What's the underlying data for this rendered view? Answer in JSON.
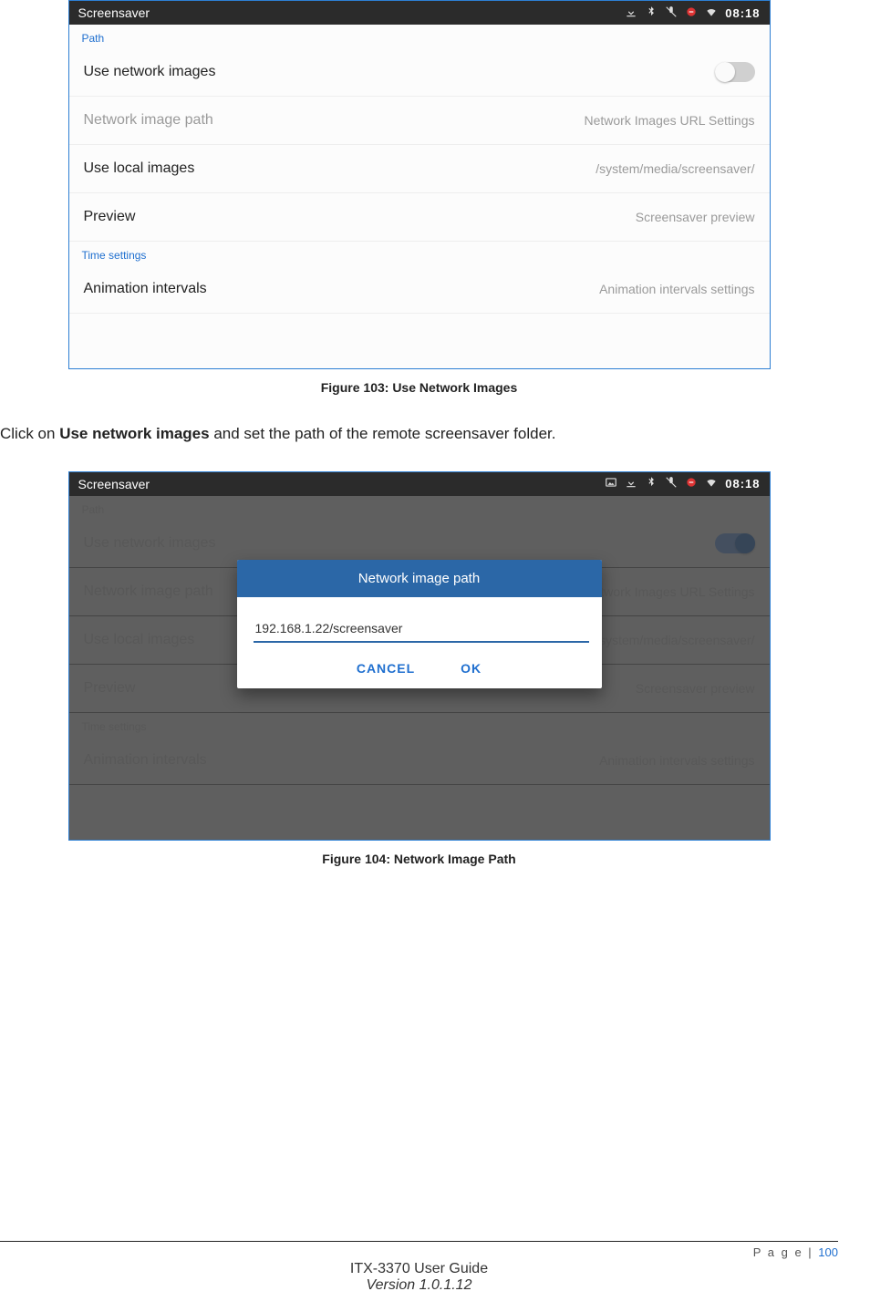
{
  "fig1": {
    "caption": "Figure 103: Use Network Images",
    "statusbar": {
      "title": "Screensaver",
      "time": "08:18"
    },
    "section_path": "Path",
    "rows": {
      "use_network_images": "Use network images",
      "network_image_path": {
        "label": "Network image path",
        "value": "Network Images URL Settings"
      },
      "use_local_images": {
        "label": "Use local images",
        "value": "/system/media/screensaver/"
      },
      "preview": {
        "label": "Preview",
        "value": "Screensaver preview"
      }
    },
    "section_time": "Time settings",
    "animation_intervals": {
      "label": "Animation intervals",
      "value": "Animation intervals settings"
    }
  },
  "body": {
    "pre": "Click on ",
    "bold": "Use network images",
    "post": " and set the path of the remote screensaver folder."
  },
  "fig2": {
    "caption": "Figure 104: Network Image Path",
    "statusbar": {
      "title": "Screensaver",
      "time": "08:18"
    },
    "section_path": "Path",
    "rows": {
      "use_network_images": "Use network images",
      "network_image_path": {
        "label": "Network image path",
        "value": "Network Images URL Settings"
      },
      "use_local_images": {
        "label": "Use local images",
        "value": "/system/media/screensaver/"
      },
      "preview": {
        "label": "Preview",
        "value": "Screensaver preview"
      }
    },
    "section_time": "Time settings",
    "animation_intervals": {
      "label": "Animation intervals",
      "value": "Animation intervals settings"
    },
    "dialog": {
      "title": "Network image path",
      "input": "192.168.1.22/screensaver",
      "cancel": "CANCEL",
      "ok": "OK"
    }
  },
  "footer": {
    "page_label": "P a g e | ",
    "page_num": "100",
    "title": "ITX-3370 User Guide",
    "version": "Version 1.0.1.12"
  }
}
